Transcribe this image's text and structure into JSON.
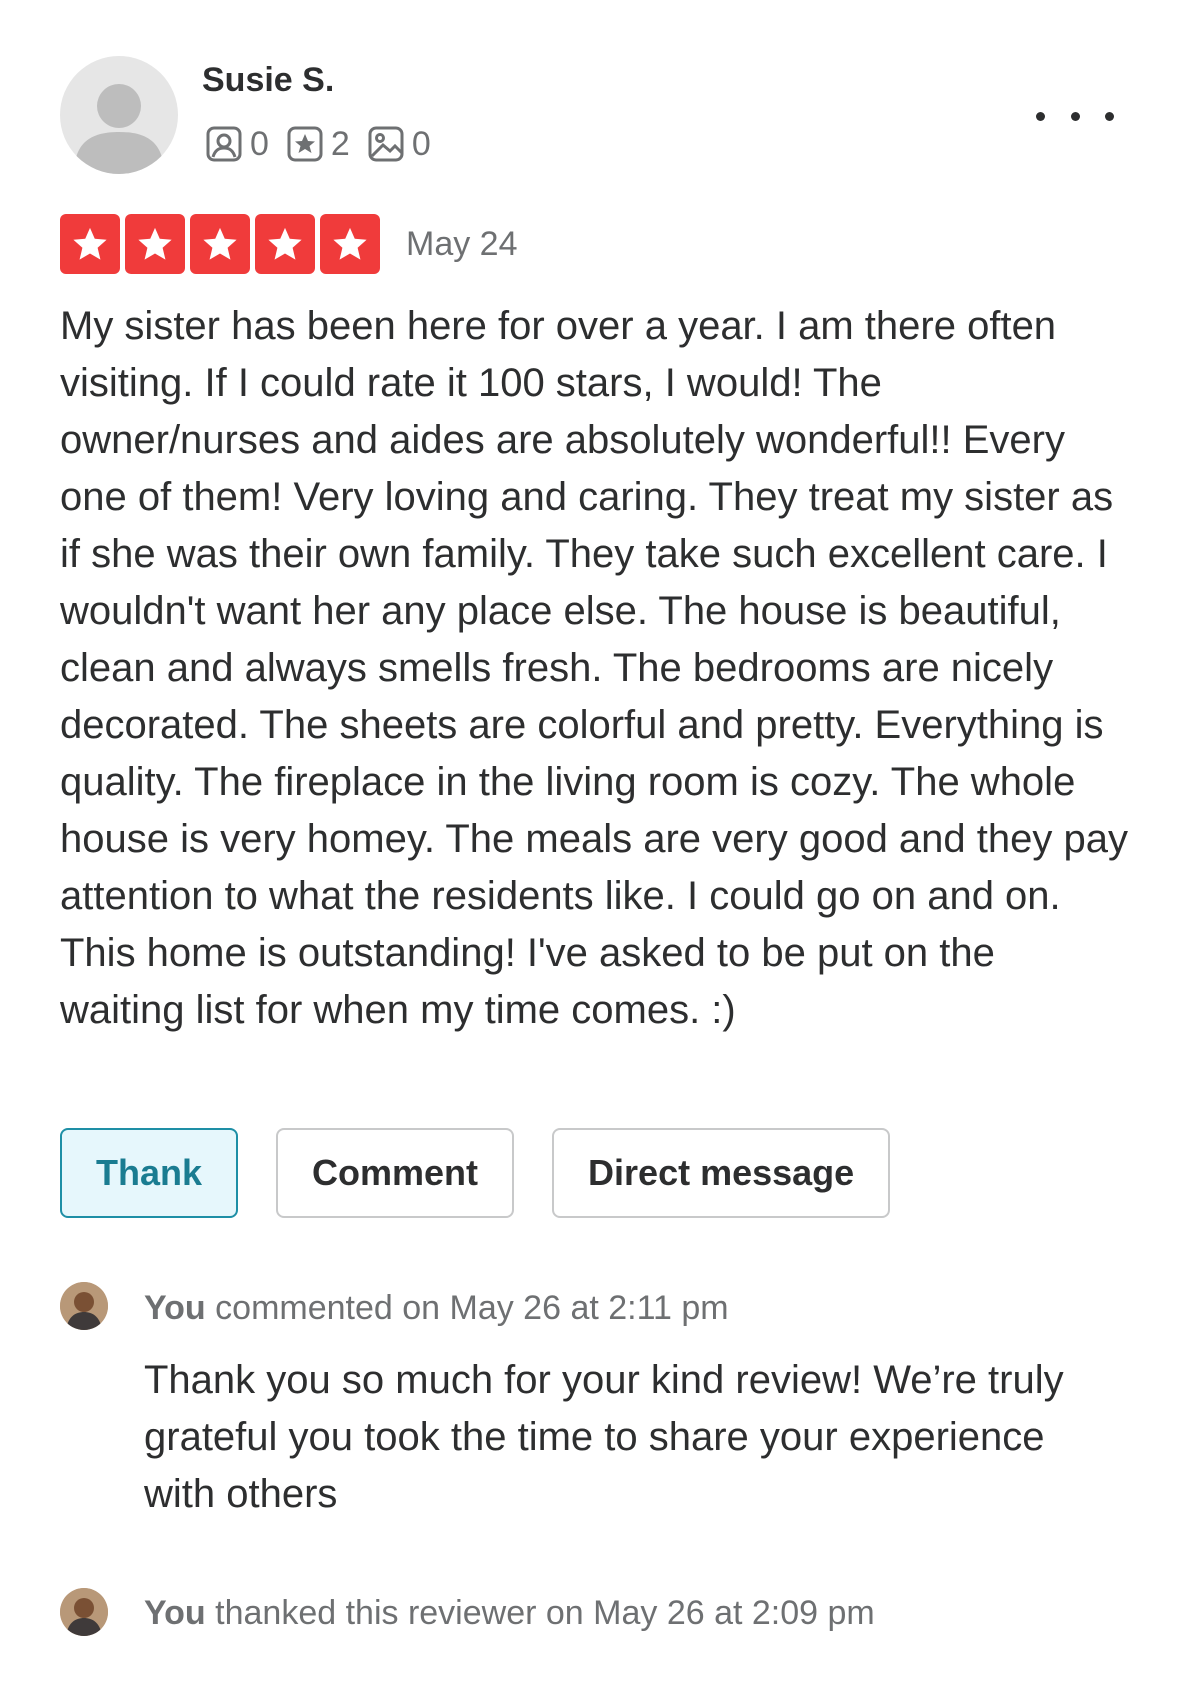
{
  "reviewer": {
    "name": "Susie S.",
    "stats": [
      {
        "icon": "friends-icon",
        "count": "0"
      },
      {
        "icon": "review-star-icon",
        "count": "2"
      },
      {
        "icon": "photo-icon",
        "count": "0"
      }
    ]
  },
  "review": {
    "rating": 5,
    "rating_color": "#f03b3b",
    "date": "May 24",
    "text": "My sister has been here for over a year.  I am there often visiting.  If I could rate it 100 stars, I would!  The owner/nurses and aides are absolutely wonderful!! Every one of them!  Very loving and caring.   They treat my sister as if she was their own family.  They take such excellent care.  I wouldn't want her any place else.  The house is beautiful, clean and always smells fresh.  The bedrooms are nicely decorated. The sheets are colorful and pretty.  Everything is quality. The fireplace in the living room is cozy.  The whole house is very homey. The meals are very good and they pay attention to what the residents like.  I could go on and on.  This home is outstanding!  I've asked to be put on the waiting list for when my time comes. :)"
  },
  "actions": {
    "thank_label": "Thank",
    "comment_label": "Comment",
    "message_label": "Direct message"
  },
  "activity": {
    "comment": {
      "actor": "You",
      "meta": "commented on May 26 at 2:11 pm",
      "text": "Thank you so much for your kind review! We’re truly grateful you took the time to share your experience with others"
    },
    "thanked": {
      "actor": "You",
      "meta": "thanked this reviewer on May 26 at 2:09 pm"
    }
  }
}
